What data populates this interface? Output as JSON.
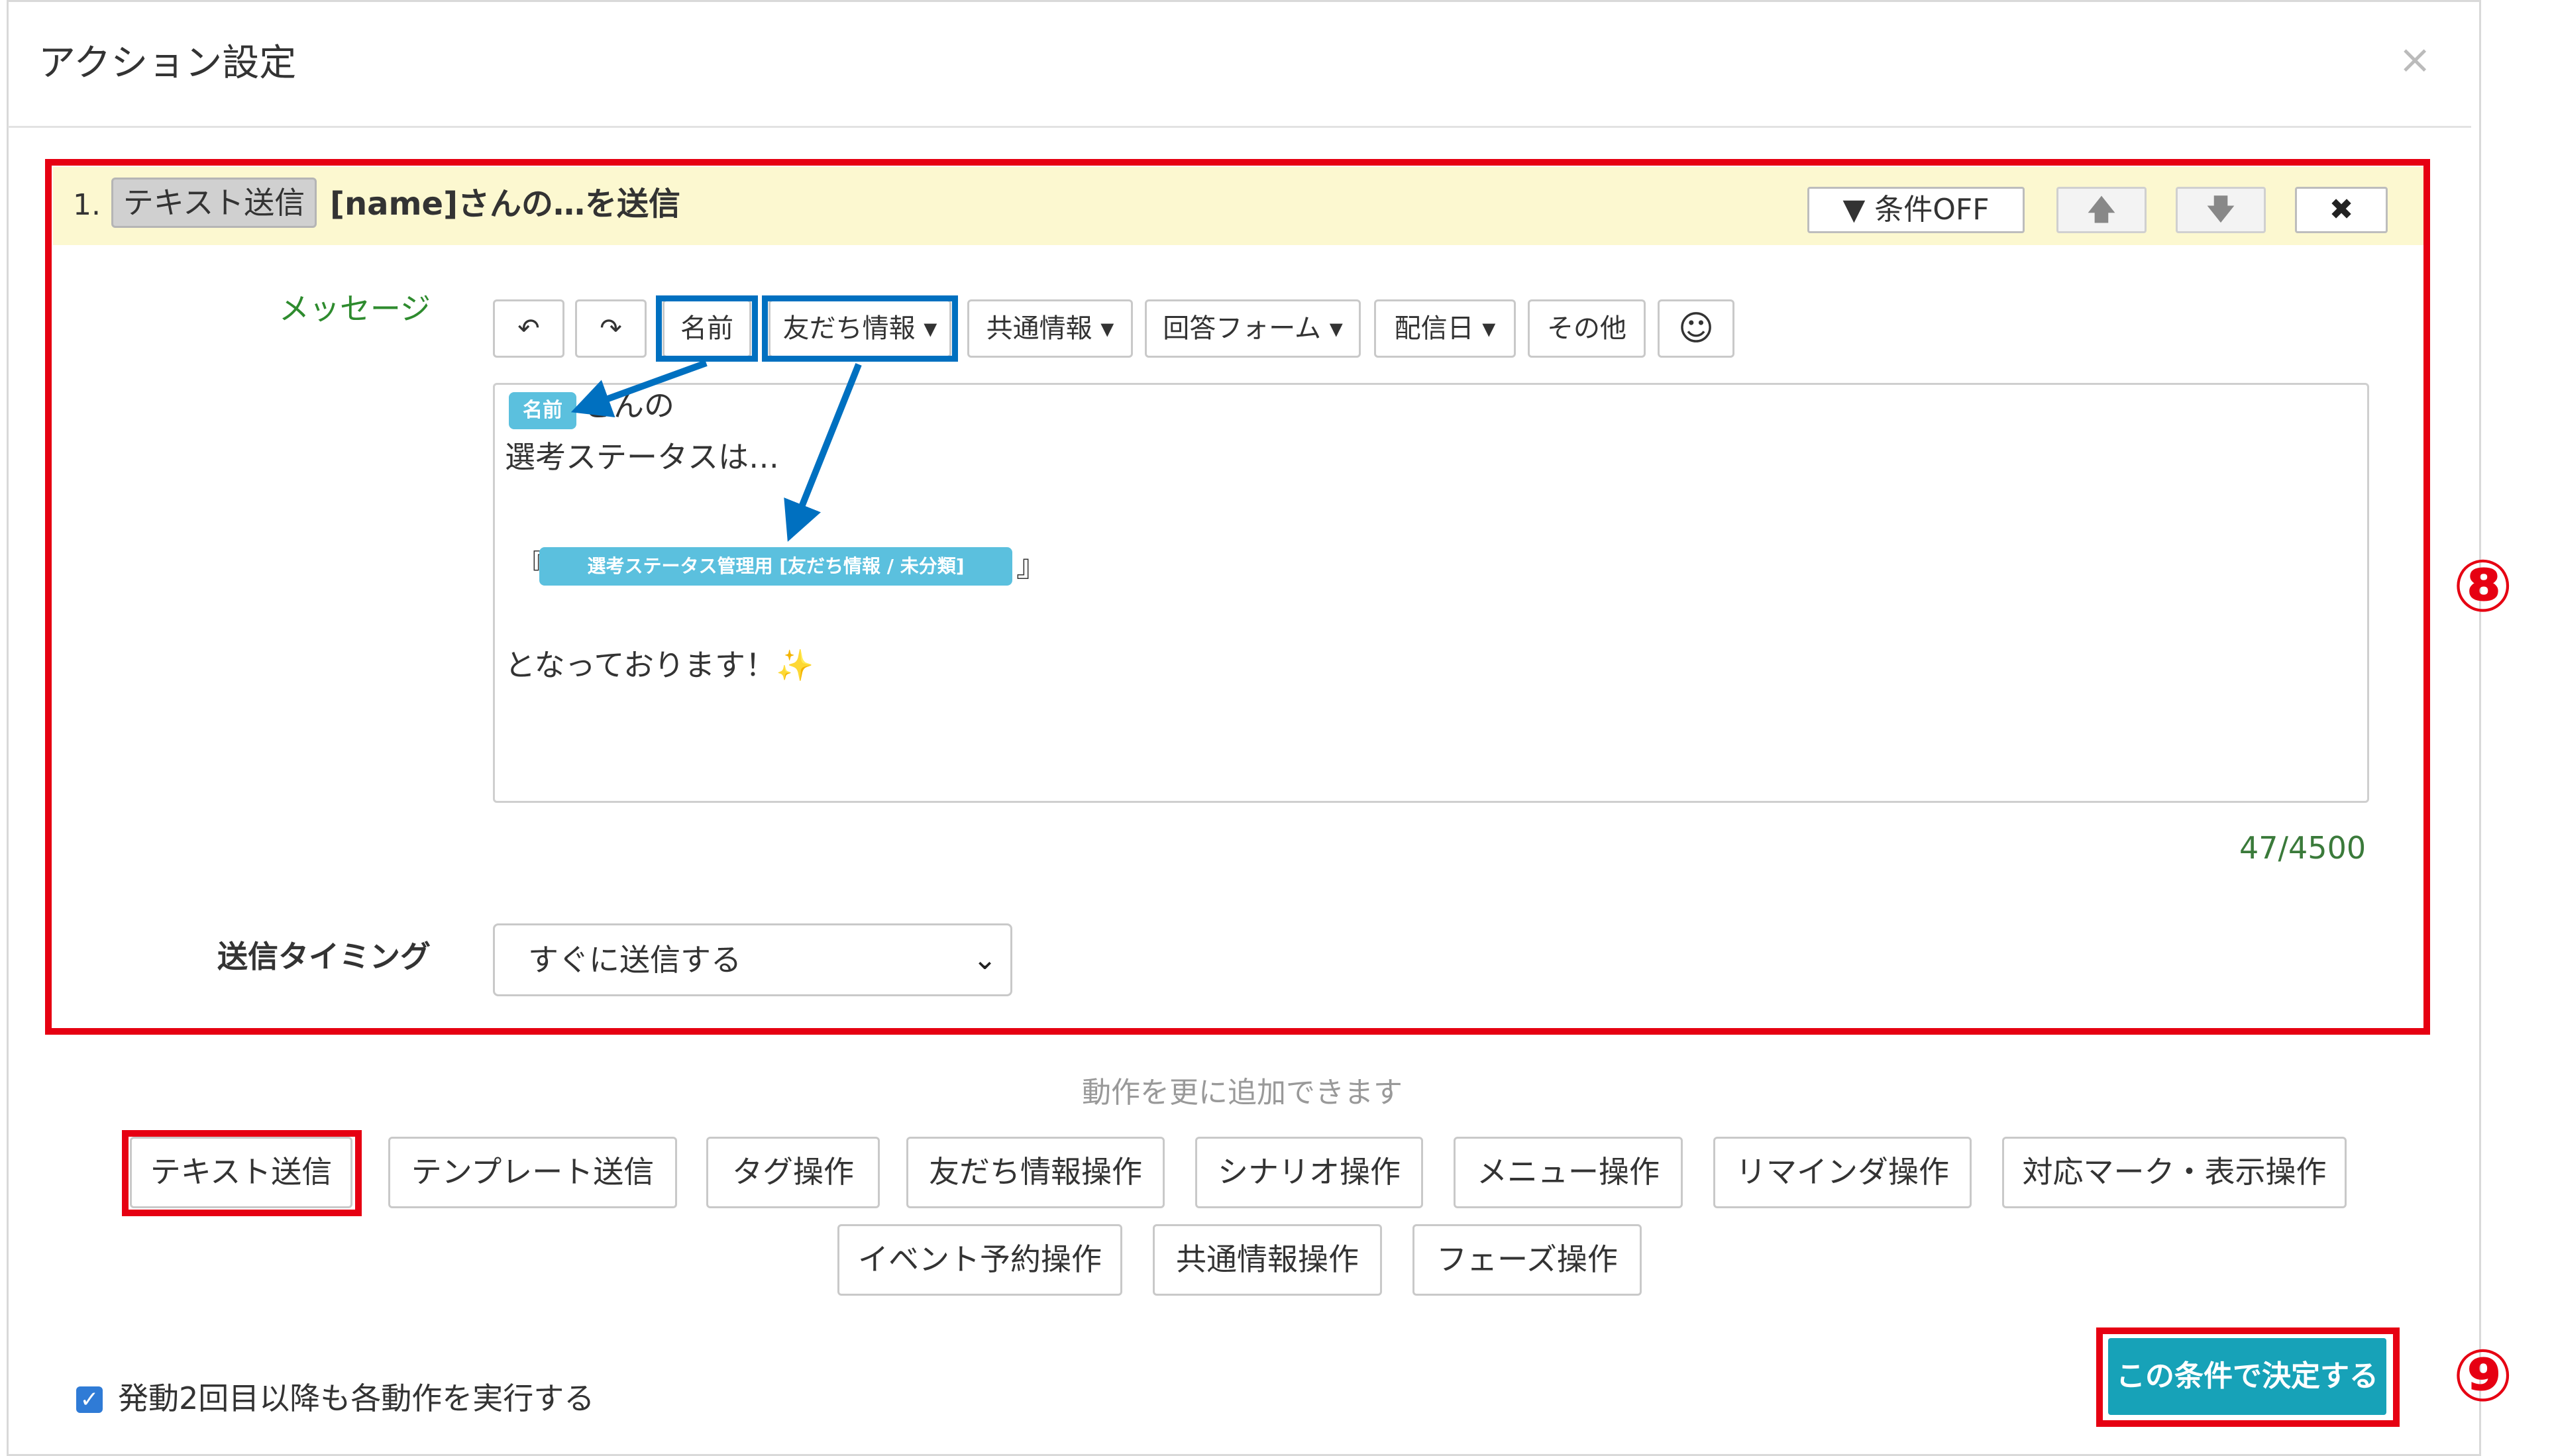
{
  "modal": {
    "title": "アクション設定",
    "close_symbol": "×"
  },
  "action": {
    "number": "1.",
    "type_badge": "テキスト送信",
    "title": "[name]さんの…を送信",
    "condition_button": "条件OFF",
    "up_symbol": "🡅",
    "down_symbol": "🡇",
    "remove_symbol": "✖"
  },
  "message": {
    "label": "メッセージ",
    "toolbar": {
      "undo": "↶",
      "redo": "↷",
      "name": "名前",
      "friend_info": "友だち情報 ▾",
      "shared_info": "共通情報 ▾",
      "answer_form": "回答フォーム ▾",
      "delivery_date": "配信日 ▾",
      "other": "その他",
      "emoji": "☺"
    },
    "body": {
      "name_chip": "名前",
      "line1_suffix": "さんの",
      "line2": "選考ステータスは…",
      "bracket_open": "『",
      "field_chip": "選考ステータス管理用 [友だち情報 / 未分類]",
      "bracket_close": "』",
      "line4": "となっております！✨"
    },
    "counter": "47/4500"
  },
  "timing": {
    "label": "送信タイミング",
    "selected": "すぐに送信する",
    "chevron": "⌄"
  },
  "add_actions": {
    "hint": "動作を更に追加できます",
    "buttons_row1": [
      "テキスト送信",
      "テンプレート送信",
      "タグ操作",
      "友だち情報操作",
      "シナリオ操作",
      "メニュー操作",
      "リマインダ操作",
      "対応マーク・表示操作"
    ],
    "buttons_row2": [
      "イベント予約操作",
      "共通情報操作",
      "フェーズ操作"
    ]
  },
  "footer": {
    "checkbox_checked": true,
    "checkbox_mark": "✓",
    "checkbox_label": "発動2回目以降も各動作を実行する",
    "confirm_button": "この条件で決定する"
  },
  "annotations": {
    "marker8": "⑧",
    "marker9": "⑨",
    "red": "#e60012",
    "blue": "#0070c0"
  },
  "colors": {
    "chip": "#5bc0de",
    "confirm": "#17a2b8",
    "header_bg": "#fcf8d0",
    "counter": "#3a7a3a"
  }
}
